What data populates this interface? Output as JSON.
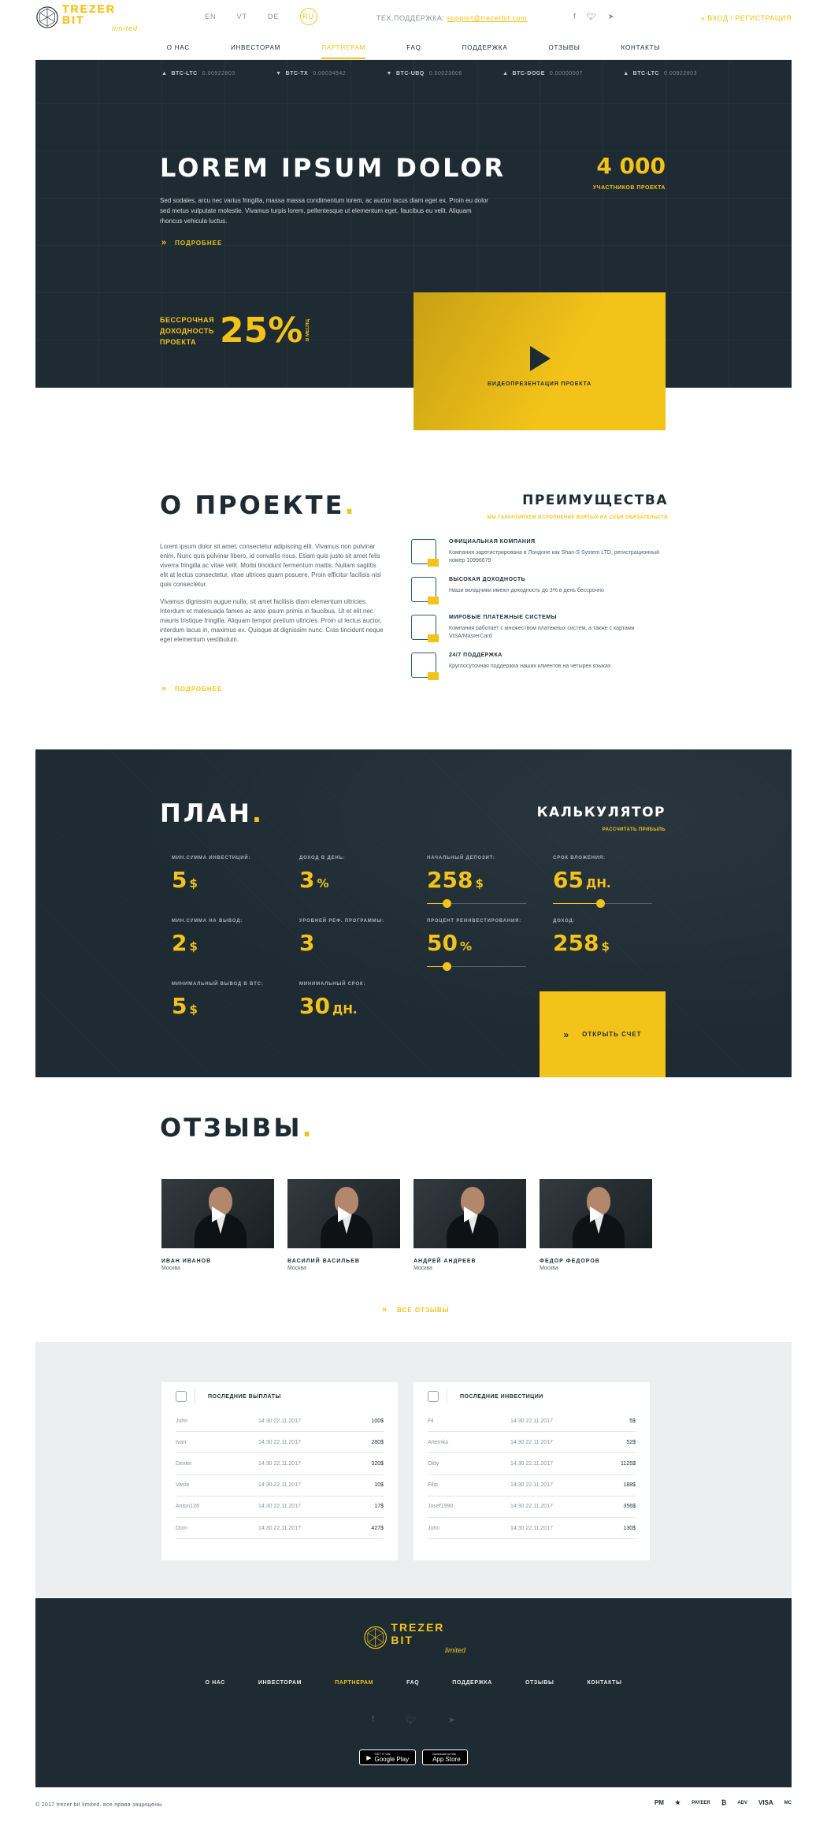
{
  "header": {
    "logo_main": "TREZER BIT",
    "logo_sub": "limited",
    "languages": [
      "EN",
      "VT",
      "DE",
      "RU"
    ],
    "active_language": "RU",
    "support_label": "ТЕХ.ПОДДЕРЖКА:",
    "support_email": "support@trezerbit.com",
    "social_icons": [
      "facebook-icon",
      "twitter-icon",
      "telegram-icon"
    ],
    "login_label": "ВХОД / РЕГИСТРАЦИЯ"
  },
  "nav": {
    "items": [
      "О НАС",
      "ИНВЕСТОРАМ",
      "ПАРТНЕРАМ",
      "FAQ",
      "ПОДДЕРЖКА",
      "ОТЗЫВЫ",
      "КОНТАКТЫ"
    ],
    "active": "ПАРТНЕРАМ"
  },
  "ticker": [
    {
      "pair": "BTC-LTC",
      "value": "0.00922803"
    },
    {
      "pair": "BTC-TX",
      "value": "0.00034542"
    },
    {
      "pair": "BTC-UBQ",
      "value": "0.00023006"
    },
    {
      "pair": "BTC-DOGE",
      "value": "0.00000007"
    },
    {
      "pair": "BTC-LTC",
      "value": "0.00922803"
    }
  ],
  "hero": {
    "title": "LOREM IPSUM DOLOR",
    "text": "Sed sodales, arcu nec varius fringilla, massa massa condimentum lorem, ac auctor lacus diam eget ex. Proin eu dolor sed metus vulputate molestie. Vivamus turpis lorem, pellentesque ut elementum eget, faucibus eu velit. Aliquam rhoncus vehicula luctus.",
    "more": "ПОДРОБНЕЕ",
    "stat_value": "4 000",
    "stat_label": "УЧАСТНИКОВ ПРОЕКТА",
    "yield_label": "БЕССРОЧНАЯ ДОХОДНОСТЬ ПРОЕКТА",
    "yield_value": "25%",
    "yield_period": "В МЕСЯЦ",
    "video_caption": "ВИДЕОПРЕЗЕНТАЦИЯ ПРОЕКТА"
  },
  "about": {
    "title": "О ПРОЕКТЕ",
    "p1": "Lorem ipsum dolor sit amet, consectetur adipiscing elit. Vivamus non pulvinar enim. Nunc quis pulvinar libero, id convallis risus. Etiam quis justo sit amet felis viverra fringilla ac vitae velit. Morbi tincidunt fermentum mattis. Nullam sagittis elit at lectus consectetur, vitae ultrices quam posuere. Proin efficitur facilisis nisl quis consectetur.",
    "p2": "Vivamus dignissim augue nulla, sit amet facilisis diam elementum ultricies. Interdum et malesuada fames ac ante ipsum primis in faucibus. Ut et elit nec mauris tristique fringilla. Aliquam tempor pretium ultricies. Proin ut lectus auctor, interdum lacus in, maximus ex. Quisque at dignissim nunc. Cras tincidunt neque eget elementum vestibulum.",
    "more": "ПОДРОБНЕЕ"
  },
  "advantages": {
    "title": "ПРЕИМУЩЕСТВА",
    "subtitle": "МЫ ГАРАНТИРУЕМ ИСПОЛНЕНИЕ ВЗЯТЫХ НА СЕБЯ ОБЯЗАТЕЛЬСТВ",
    "items": [
      {
        "icon": "briefcase-icon",
        "title": "ОФИЦИАЛЬНАЯ КОМПАНИЯ",
        "text": "Компания зарегистрирована в Лондоне как Shan-S System LTD, регистрационный номер 10996679"
      },
      {
        "icon": "growth-chart-icon",
        "title": "ВЫСОКАЯ ДОХОДНОСТЬ",
        "text": "Наши вкладчики имеют доходность до 3% в день бессрочно"
      },
      {
        "icon": "payment-systems-icon",
        "title": "МИРОВЫЕ ПЛАТЕЖНЫЕ СИСТЕМЫ",
        "text": "Компания работает с множеством платежных систем, а также с картами VISA/MasterCard"
      },
      {
        "icon": "support-icon",
        "title": "24/7 ПОДДЕРЖКА",
        "text": "Круглосуточная поддержка наших клиентов на четырех языках"
      }
    ]
  },
  "plan": {
    "title": "ПЛАН",
    "cells": [
      {
        "label": "МИН.СУММА ИНВЕСТИЦИЙ:",
        "value": "5",
        "unit": "$"
      },
      {
        "label": "ДОХОД В ДЕНЬ:",
        "value": "3",
        "unit": "%"
      },
      {
        "label": "МИН.СУММА НА ВЫВОД:",
        "value": "2",
        "unit": "$"
      },
      {
        "label": "УРОВНЕЙ РЕФ. ПРОГРАММЫ:",
        "value": "3",
        "unit": ""
      },
      {
        "label": "МИНИМАЛЬНЫЙ ВЫВОД В BTC:",
        "value": "5",
        "unit": "$"
      },
      {
        "label": "МИНИМАЛЬНЫЙ СРОК:",
        "value": "30",
        "unit": "ДН."
      }
    ]
  },
  "calculator": {
    "title": "КАЛЬКУЛЯТОР",
    "subtitle": "РАССЧИТАТЬ ПРИБЫЛЬ",
    "deposit_label": "НАЧАЛЬНЫЙ ДЕПОЗИТ:",
    "deposit_value": "258",
    "deposit_unit": "$",
    "deposit_slider": 0.2,
    "term_label": "СРОК ВЛОЖЕНИЯ:",
    "term_value": "65",
    "term_unit": "ДН.",
    "term_slider": 0.48,
    "reinvest_label": "ПРОЦЕНТ РЕИНВЕСТИРОВАНИЯ:",
    "reinvest_value": "50",
    "reinvest_unit": "%",
    "reinvest_slider": 0.2,
    "income_label": "ДОХОД:",
    "income_value": "258",
    "income_unit": "$",
    "open_button": "ОТКРЫТЬ СЧЕТ"
  },
  "reviews": {
    "title": "ОТЗЫВЫ",
    "items": [
      {
        "name": "ИВАН ИВАНОВ",
        "city": "Москва"
      },
      {
        "name": "ВАСИЛИЙ ВАСИЛЬЕВ",
        "city": "Москва"
      },
      {
        "name": "АНДРЕЙ АНДРЕЕВ",
        "city": "Москва"
      },
      {
        "name": "ФЕДОР ФЕДОРОВ",
        "city": "Москва"
      }
    ],
    "all_link": "ВСЕ ОТЗЫВЫ"
  },
  "payouts": {
    "title": "ПОСЛЕДНИЕ ВЫПЛАТЫ",
    "rows": [
      {
        "name": "John",
        "time": "14:30 22.11.2017",
        "amount": "100$"
      },
      {
        "name": "Ivan",
        "time": "14:30 22.11.2017",
        "amount": "280$"
      },
      {
        "name": "Dexter",
        "time": "14:30 22.11.2017",
        "amount": "320$"
      },
      {
        "name": "Vasia",
        "time": "14:30 22.11.2017",
        "amount": "10$"
      },
      {
        "name": "Anton126",
        "time": "14:30 22.11.2017",
        "amount": "17$"
      },
      {
        "name": "Dom",
        "time": "14:30 22.11.2017",
        "amount": "427$"
      }
    ]
  },
  "investments": {
    "title": "ПОСЛЕДНИЕ ИНВЕСТИЦИИ",
    "rows": [
      {
        "name": "Fil",
        "time": "14:30 22.11.2017",
        "amount": "5$"
      },
      {
        "name": "Artemka",
        "time": "14:30 22.11.2017",
        "amount": "52$"
      },
      {
        "name": "Oldy",
        "time": "14:30 22.11.2017",
        "amount": "1125$"
      },
      {
        "name": "Filip",
        "time": "14:30 22.11.2017",
        "amount": "188$"
      },
      {
        "name": "Josef1990",
        "time": "14:30 22.11.2017",
        "amount": "356$"
      },
      {
        "name": "John",
        "time": "14:30 22.11.2017",
        "amount": "130$"
      }
    ]
  },
  "footer": {
    "logo_main": "TREZER BIT",
    "logo_sub": "limited",
    "nav": [
      "О НАС",
      "ИНВЕСТОРАМ",
      "ПАРТНЕРАМ",
      "FAQ",
      "ПОДДЕРЖКА",
      "ОТЗЫВЫ",
      "КОНТАКТЫ"
    ],
    "active": "ПАРТНЕРАМ",
    "google_top": "GET IT ON",
    "google_label": "Google Play",
    "apple_top": "Download on the",
    "apple_label": "App Store",
    "copyright": "© 2017 trezer bit limited. все права защищены",
    "payments": [
      "PM",
      "★",
      "PAYEER",
      "₿",
      "ADV",
      "VISA",
      "MC"
    ]
  },
  "colors": {
    "accent": "#f3c319",
    "dark": "#1e2b33",
    "light_band": "#eceef0"
  }
}
